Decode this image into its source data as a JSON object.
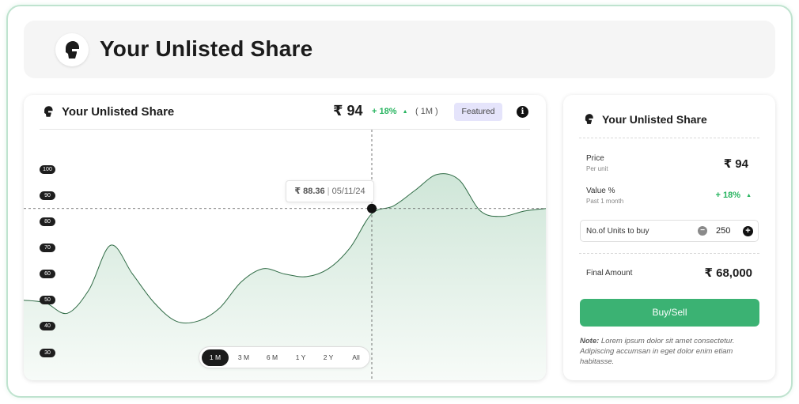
{
  "banner": {
    "title": "Your Unlisted Share",
    "logo_icon": "helmet-head-icon"
  },
  "chart_card": {
    "title": "Your Unlisted Share",
    "price": "₹ 94",
    "change": "+ 18%",
    "change_arrow": "▲",
    "period": "( 1M )",
    "badge": "Featured",
    "info_icon": "i",
    "tooltip_price": "₹ 88.36",
    "tooltip_sep": " | ",
    "tooltip_date": "05/11/24",
    "range_buttons": [
      "1 M",
      "3 M",
      "6 M",
      "1 Y",
      "2 Y",
      "All"
    ],
    "active_range": "1 M"
  },
  "chart_data": {
    "type": "area",
    "y_ticks": [
      100,
      90,
      80,
      70,
      60,
      50,
      40,
      30
    ],
    "ylim": [
      30,
      100
    ],
    "points": [
      [
        0,
        50
      ],
      [
        2.5,
        49
      ],
      [
        5,
        45
      ],
      [
        7.5,
        54
      ],
      [
        10,
        71
      ],
      [
        12.5,
        60
      ],
      [
        15,
        49
      ],
      [
        17.5,
        42
      ],
      [
        20,
        42
      ],
      [
        22.5,
        47
      ],
      [
        25,
        57
      ],
      [
        27.5,
        62
      ],
      [
        30,
        60
      ],
      [
        32.5,
        59
      ],
      [
        35,
        62
      ],
      [
        37.5,
        70
      ],
      [
        40,
        83
      ],
      [
        42.5,
        86
      ],
      [
        45,
        92
      ],
      [
        47.5,
        98
      ],
      [
        50,
        96
      ],
      [
        52.5,
        84
      ],
      [
        55,
        82
      ],
      [
        57.5,
        84
      ],
      [
        60,
        85
      ]
    ],
    "highlight": {
      "x": 40,
      "y": 85,
      "label": "₹ 88.36 | 05/11/24"
    },
    "colors": {
      "line": "#2f6b45",
      "fill_top": "#cfe6d8",
      "fill_bottom": "#f7fbf8",
      "point": "#111111"
    }
  },
  "side_card": {
    "title": "Your Unlisted Share",
    "price_label": "Price",
    "price_sub": "Per unit",
    "price_value": "₹ 94",
    "value_label": "Value %",
    "value_sub": "Past 1 month",
    "value_change": "+ 18%",
    "value_arrow": "▲",
    "units_label": "No.of Units to buy",
    "units_value": "250",
    "minus": "−",
    "plus": "+",
    "final_label": "Final Amount",
    "final_value": "₹ 68,000",
    "button_label": "Buy/Sell",
    "note_label": "Note:",
    "note_text": " Lorem ipsum dolor sit amet consectetur. Adipiscing accumsan in eget dolor enim etiam habitasse."
  },
  "colors": {
    "accent": "#3bb273",
    "positive": "#27b45f",
    "badge_bg": "#e5e4fb",
    "border": "#bfe3cf"
  }
}
